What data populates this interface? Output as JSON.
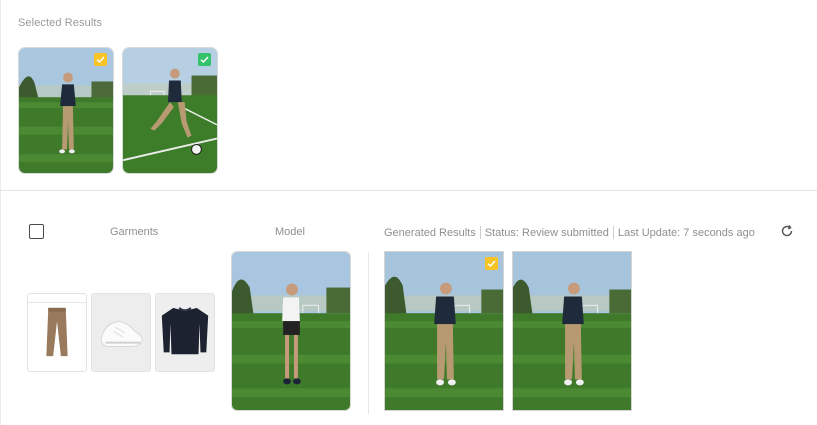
{
  "selected": {
    "title": "Selected Results",
    "items": [
      {
        "badge": "yellow-check",
        "badge_color": "#f7c325"
      },
      {
        "badge": "green-check",
        "badge_color": "#34c26a"
      }
    ]
  },
  "table": {
    "columns": {
      "garments": "Garments",
      "model": "Model"
    },
    "generated": {
      "label": "Generated Results",
      "status": "Status: Review submitted",
      "last_update": "Last Update: 7 seconds ago"
    },
    "garments": [
      {
        "name": "khaki-trousers"
      },
      {
        "name": "white-sneakers"
      },
      {
        "name": "navy-sweater"
      }
    ],
    "results": [
      {
        "badge": "yellow-check",
        "badge_color": "#f7c325"
      },
      {
        "badge": "none"
      }
    ]
  },
  "icons": {
    "refresh": "refresh-icon",
    "checkbox": "select-all-checkbox"
  },
  "colors": {
    "selected_badge_yellow": "#f7c325",
    "selected_badge_green": "#34c26a",
    "grass": "#3f7a2a",
    "sky": "#9cc1dc"
  }
}
